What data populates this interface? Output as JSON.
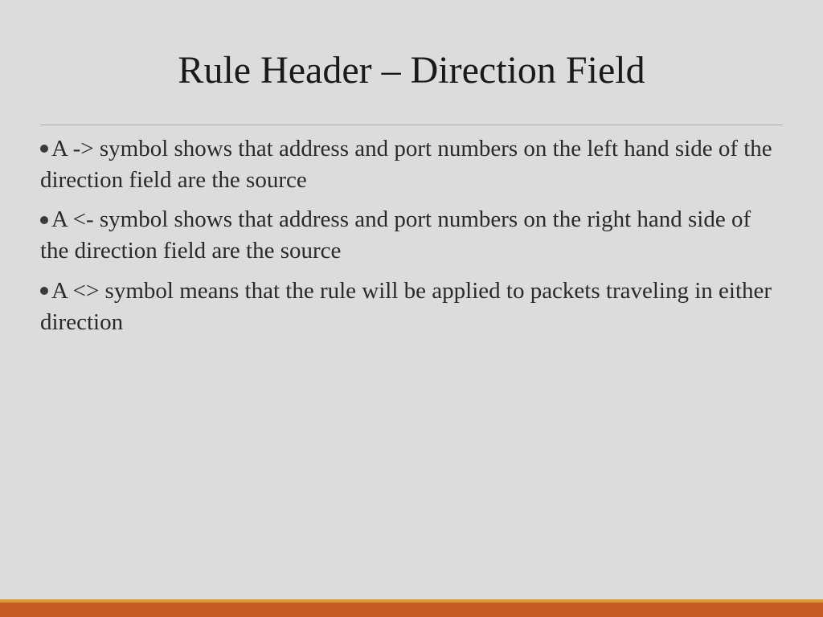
{
  "slide": {
    "title": "Rule Header – Direction Field",
    "bullets": [
      "A -> symbol shows that address and port numbers on the left hand side of the direction field are the source",
      "A <- symbol shows that address and port numbers on the right hand side of the direction field are the source",
      "A <> symbol means that the rule will be applied to packets traveling in either direction"
    ]
  }
}
